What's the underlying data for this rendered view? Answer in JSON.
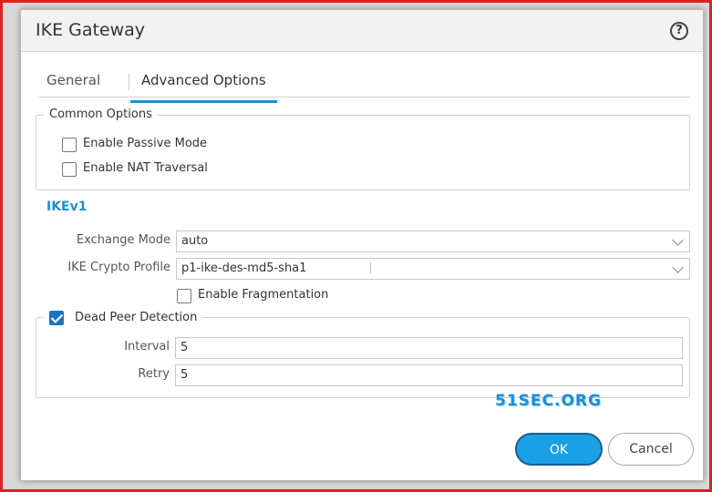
{
  "dialog": {
    "title": "IKE Gateway",
    "help_icon": "help-circle-icon"
  },
  "tabs": [
    {
      "label": "General",
      "active": false
    },
    {
      "label": "Advanced Options",
      "active": true
    }
  ],
  "common_options": {
    "legend": "Common Options",
    "passive_mode": {
      "label": "Enable Passive Mode",
      "checked": false
    },
    "nat_traversal": {
      "label": "Enable NAT Traversal",
      "checked": false
    }
  },
  "ikev1": {
    "heading": "IKEv1",
    "exchange_mode": {
      "label": "Exchange Mode",
      "value": "auto"
    },
    "crypto_profile": {
      "label": "IKE Crypto Profile",
      "value": "p1-ike-des-md5-sha1"
    },
    "fragmentation": {
      "label": "Enable Fragmentation",
      "checked": false
    },
    "dpd": {
      "legend": "Dead Peer Detection",
      "checked": true,
      "interval": {
        "label": "Interval",
        "value": "5"
      },
      "retry": {
        "label": "Retry",
        "value": "5"
      }
    }
  },
  "watermark": "51SEC.ORG",
  "buttons": {
    "ok": "OK",
    "cancel": "Cancel"
  },
  "colors": {
    "accent": "#1a8fd6",
    "ok_button": "#1aa0e6",
    "frame": "#e02020"
  }
}
